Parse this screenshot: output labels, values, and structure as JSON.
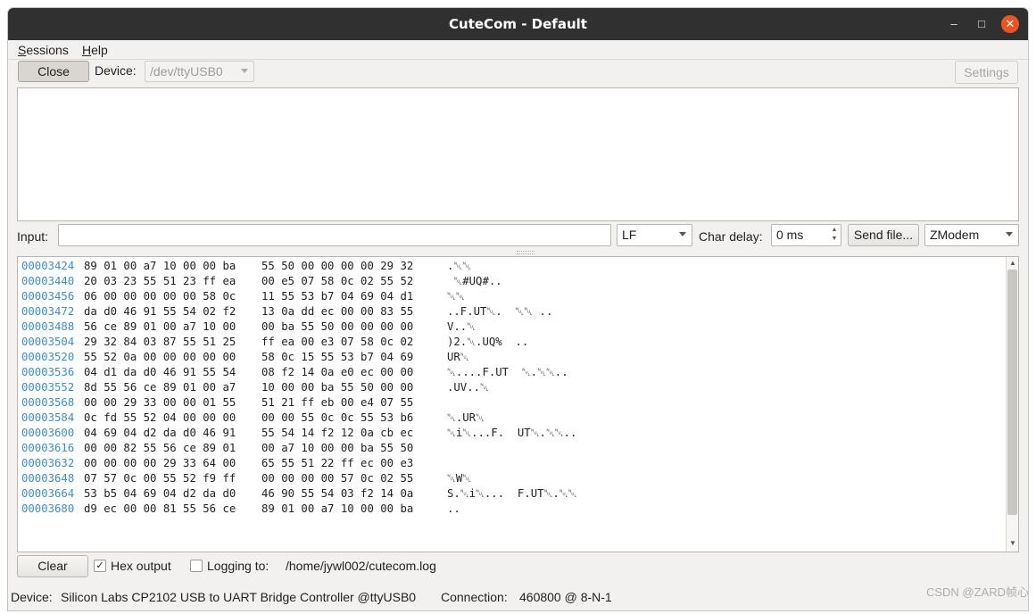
{
  "window": {
    "title": "CuteCom - Default",
    "controls": {
      "minimize": "–",
      "maximize": "□",
      "close": "✕"
    }
  },
  "menu": {
    "sessions_first": "S",
    "sessions_rest": "essions",
    "help_first": "H",
    "help_rest": "elp"
  },
  "toolbar": {
    "close_label": "Close",
    "device_label": "Device:",
    "device_value": "/dev/ttyUSB0",
    "settings_label": "Settings"
  },
  "input_row": {
    "input_label": "Input:",
    "input_value": "",
    "line_end": "LF",
    "char_delay_label": "Char delay:",
    "char_delay_value": "0 ms",
    "send_file_label": "Send file...",
    "protocol": "ZModem"
  },
  "output": {
    "rows": [
      {
        "addr": "00003424",
        "hex1": "89 01 00 a7 10 00 00 ba",
        "hex2": "55 50 00 00 00 00 29 32",
        "ascii": ".␀␀"
      },
      {
        "addr": "00003440",
        "hex1": "20 03 23 55 51 23 ff ea",
        "hex2": "00 e5 07 58 0c 02 55 52",
        "ascii": " ␀#UQ#.."
      },
      {
        "addr": "00003456",
        "hex1": "06 00 00 00 00 00 58 0c",
        "hex2": "11 55 53 b7 04 69 04 d1",
        "ascii": "␀␀"
      },
      {
        "addr": "00003472",
        "hex1": "da d0 46 91 55 54 02 f2",
        "hex2": "13 0a dd ec 00 00 83 55",
        "ascii": "..F.UT␀.  ␀␀ .."
      },
      {
        "addr": "00003488",
        "hex1": "56 ce 89 01 00 a7 10 00",
        "hex2": "00 ba 55 50 00 00 00 00",
        "ascii": "V..␀"
      },
      {
        "addr": "00003504",
        "hex1": "29 32 84 03 87 55 51 25",
        "hex2": "ff ea 00 e3 07 58 0c 02",
        "ascii": ")2.␀.UQ%  .."
      },
      {
        "addr": "00003520",
        "hex1": "55 52 0a 00 00 00 00 00",
        "hex2": "58 0c 15 55 53 b7 04 69",
        "ascii": "UR␀"
      },
      {
        "addr": "00003536",
        "hex1": "04 d1 da d0 46 91 55 54",
        "hex2": "08 f2 14 0a e0 ec 00 00",
        "ascii": "␀....F.UT  ␀.␀␀.."
      },
      {
        "addr": "00003552",
        "hex1": "8d 55 56 ce 89 01 00 a7",
        "hex2": "10 00 00 ba 55 50 00 00",
        "ascii": ".UV..␀"
      },
      {
        "addr": "00003568",
        "hex1": "00 00 29 33 00 00 01 55",
        "hex2": "51 21 ff eb 00 e4 07 55",
        "ascii": ""
      },
      {
        "addr": "00003584",
        "hex1": "0c fd 55 52 04 00 00 00",
        "hex2": "00 00 55 0c 0c 55 53 b6",
        "ascii": "␀.UR␀"
      },
      {
        "addr": "00003600",
        "hex1": "04 69 04 d2 da d0 46 91",
        "hex2": "55 54 14 f2 12 0a cb ec",
        "ascii": "␀i␀...F.  UT␀.␀␀.."
      },
      {
        "addr": "00003616",
        "hex1": "00 00 82 55 56 ce 89 01",
        "hex2": "00 a7 10 00 00 ba 55 50",
        "ascii": ""
      },
      {
        "addr": "00003632",
        "hex1": "00 00 00 00 29 33 64 00",
        "hex2": "65 55 51 22 ff ec 00 e3",
        "ascii": ""
      },
      {
        "addr": "00003648",
        "hex1": "07 57 0c 00 55 52 f9 ff",
        "hex2": "00 00 00 00 57 0c 02 55",
        "ascii": "␀W␀"
      },
      {
        "addr": "00003664",
        "hex1": "53 b5 04 69 04 d2 da d0",
        "hex2": "46 90 55 54 03 f2 14 0a",
        "ascii": "S.␀i␀...  F.UT␀.␀␀"
      },
      {
        "addr": "00003680",
        "hex1": "d9 ec 00 00 81 55 56 ce",
        "hex2": "89 01 00 a7 10 00 00 ba",
        "ascii": ".."
      }
    ]
  },
  "bottom": {
    "clear_label": "Clear",
    "hex_output_label": "Hex output",
    "hex_output_checked": "✓",
    "logging_label": "Logging to:",
    "log_path": "/home/jywl002/cutecom.log"
  },
  "status": {
    "device_label": "Device:",
    "device_value": "Silicon Labs CP2102 USB to UART Bridge Controller @ttyUSB0",
    "connection_label": "Connection:",
    "connection_value": "460800 @ 8-N-1"
  },
  "watermark": "CSDN @ZARD帧心"
}
